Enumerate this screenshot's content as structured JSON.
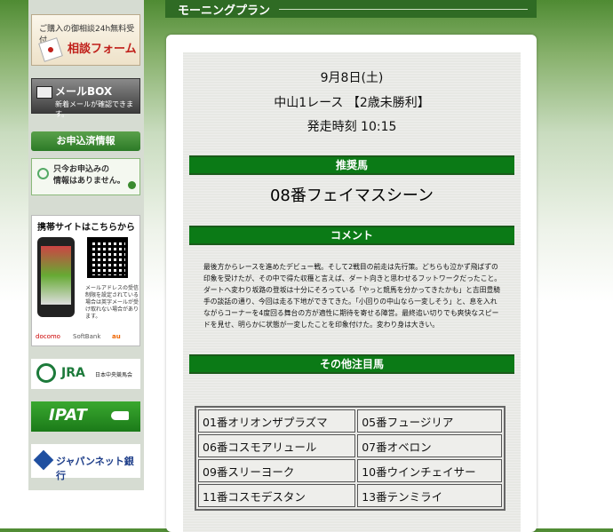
{
  "header": {
    "title": "モーニングプラン"
  },
  "sidebar": {
    "consult": {
      "line1": "ご購入の御相談24h無料受付",
      "line2": "相談フォーム"
    },
    "mailbox": {
      "title": "メールBOX",
      "sub": "新着メールが確認できます。"
    },
    "applied": {
      "title": "お申込済情報",
      "message_line1": "只今お申込みの",
      "message_line2": "情報はありません。"
    },
    "mobile": {
      "title": "携帯サイトはこちらから",
      "note": "メールアドレスの受信制限を設定されている場合は英字メールが受け取れない場合があります。",
      "carriers": [
        "docomo",
        "SoftBank",
        "au"
      ]
    },
    "jra": {
      "logo": "JRA",
      "sub": "日本中央競馬会"
    },
    "ipat": {
      "logo": "IPAT"
    },
    "bank": {
      "label": "ジャパンネット銀行"
    }
  },
  "race": {
    "date": "9月8日(土)",
    "name": "中山1レース 【2歳未勝利】",
    "start": "発走時刻 10:15"
  },
  "recommended": {
    "header": "推奨馬",
    "horse": "08番フェイマスシーン"
  },
  "comment": {
    "header": "コメント",
    "text": "最後方からレースを進めたデビュー戦。そして2戦目の前走は先行策。どちらも泣かず飛ばずの印象を受けたが、その中で得た収穫と言えば、ダート向きと思わせるフットワークだったこと。ダートへ変わり坂路の登坂は十分にそろっている「やっと競馬を分かってきたかも」と吉田豊騎手の談話の通り、今回は走る下地ができてきた。「小回りの中山なら一変しそう」と、息を入れながらコーナーを4度回る舞台の方が適性に期待を寄せる陣営。最終追い切りでも爽快なスピードを見せ、明らかに状態が一変したことを印象付けた。変わり身は大きい。"
  },
  "others": {
    "header": "その他注目馬",
    "horses": [
      [
        "01番オリオンザプラズマ",
        "05番フュージリア"
      ],
      [
        "06番コスモアリュール",
        "07番オベロン"
      ],
      [
        "09番スリーヨーク",
        "10番ウインチェイサー"
      ],
      [
        "11番コスモデスタン",
        "13番テンミライ"
      ]
    ]
  }
}
